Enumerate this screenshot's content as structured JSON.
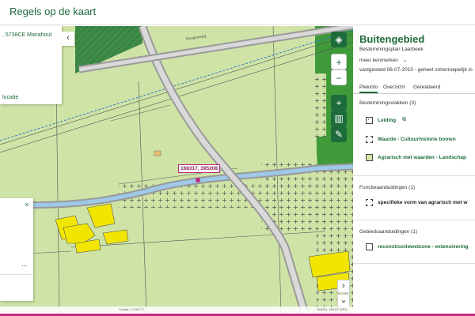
{
  "header": {
    "title": "Regels op de kaart"
  },
  "map": {
    "address_text": ", 5738CE Mariahout",
    "location_link": "locatie",
    "coordinate_label": "168317, 395208",
    "legend_close": "×",
    "legend_more": "...",
    "scale_text": "Schaal: 1:2.557 ©",
    "coords_text": "168081, 395157 (RD)",
    "collapse_icon": "chevron-left-icon",
    "street_label": "Rooijseweg"
  },
  "panel": {
    "title": "Buitengebied",
    "subtitle": "Bestemmingsplan  Laarbeek",
    "more_label": "meer kenmerken",
    "status": "vastgesteld 06-07-2010 - geheel onherroepelijk in",
    "tabs": [
      {
        "label": "Plekinfo",
        "active": true
      },
      {
        "label": "Overzicht",
        "active": false
      },
      {
        "label": "Gerelateerd",
        "active": false
      }
    ],
    "sections": [
      {
        "heading": "Bestemmingsvlakken (3)",
        "items": [
          {
            "label": "Leiding",
            "swatch": "#ffffff",
            "external": true
          },
          {
            "label": "Waarde - Cultuurhistorie bomen",
            "swatch": "#ffffff",
            "external": true
          },
          {
            "label": "Agrarisch met waarden - Landschap",
            "swatch": "#d4e6a8",
            "external": false
          }
        ]
      },
      {
        "heading": "Functieaanduidingen (1)",
        "items": [
          {
            "label": "specifieke vorm van agrarisch met w",
            "swatch": "#ffffff",
            "external": false
          }
        ]
      },
      {
        "heading": "Gebiedsaanduidingen (1)",
        "items": [
          {
            "label": "reconstructiewetzone - extensivering",
            "swatch": "#ffffff",
            "external": false
          }
        ]
      }
    ]
  },
  "colors": {
    "brand": "#1e6b3c",
    "map_field": "#cfe3a6",
    "forest": "#3f9a3a",
    "yellow_building": "#f2e600",
    "pin": "#c22a82"
  }
}
